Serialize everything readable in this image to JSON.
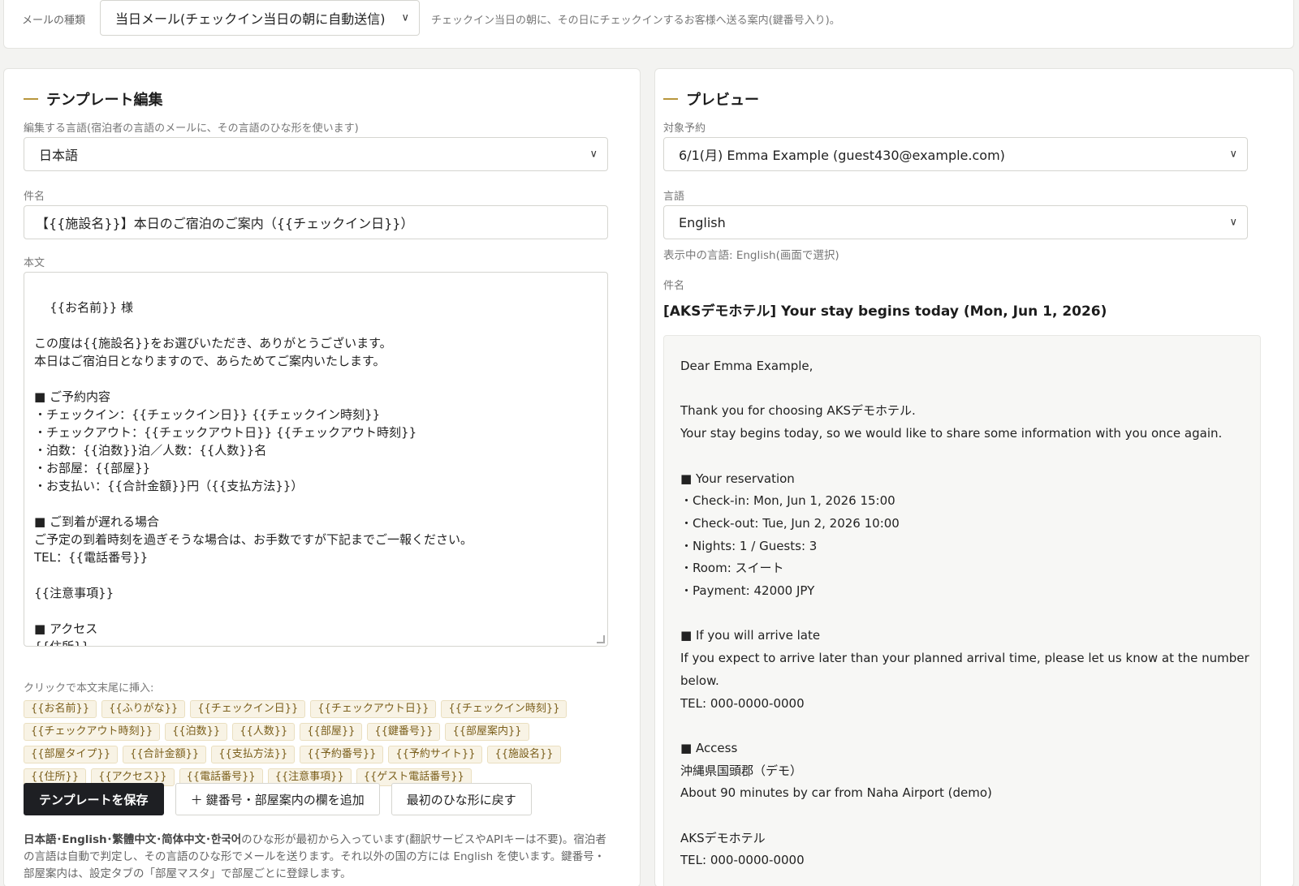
{
  "top": {
    "label": "メールの種類",
    "select_value": "当日メール(チェックイン当日の朝に自動送信)",
    "description": "チェックイン当日の朝に、その日にチェックインするお客様へ送る案内(鍵番号入り)。"
  },
  "editor": {
    "title": "テンプレート編集",
    "lang_label": "編集する言語(宿泊者の言語のメールに、その言語のひな形を使います)",
    "lang_value": "日本語",
    "subject_label": "件名",
    "subject_value": "【{{施設名}}】本日のご宿泊のご案内（{{チェックイン日}}）",
    "body_label": "本文",
    "body_value": "{{お名前}} 様\n\nこの度は{{施設名}}をお選びいただき、ありがとうございます。\n本日はご宿泊日となりますので、あらためてご案内いたします。\n\n■ ご予約内容\n・チェックイン：{{チェックイン日}} {{チェックイン時刻}}\n・チェックアウト：{{チェックアウト日}} {{チェックアウト時刻}}\n・泊数：{{泊数}}泊／人数：{{人数}}名\n・お部屋：{{部屋}}\n・お支払い：{{合計金額}}円（{{支払方法}}）\n\n■ ご到着が遅れる場合\nご予定の到着時刻を過ぎそうな場合は、お手数ですが下記までご一報ください。\nTEL：{{電話番号}}\n\n{{注意事項}}\n\n■ アクセス\n{{住所}}\n{{アクセス}}",
    "insert_hint": "クリックで本文末尾に挿入:",
    "chips": [
      "{{お名前}}",
      "{{ふりがな}}",
      "{{チェックイン日}}",
      "{{チェックアウト日}}",
      "{{チェックイン時刻}}",
      "{{チェックアウト時刻}}",
      "{{泊数}}",
      "{{人数}}",
      "{{部屋}}",
      "{{鍵番号}}",
      "{{部屋案内}}",
      "{{部屋タイプ}}",
      "{{合計金額}}",
      "{{支払方法}}",
      "{{予約番号}}",
      "{{予約サイト}}",
      "{{施設名}}",
      "{{住所}}",
      "{{アクセス}}",
      "{{電話番号}}",
      "{{注意事項}}",
      "{{ゲスト電話番号}}"
    ],
    "save_button": "テンプレートを保存",
    "add_button": "＋ 鍵番号・部屋案内の欄を追加",
    "reset_button": "最初のひな形に戻す",
    "note_bold": "日本語･English･繁體中文･简体中文･한국어",
    "note_rest": "のひな形が最初から入っています(翻訳サービスやAPIキーは不要)。宿泊者の言語は自動で判定し、その言語のひな形でメールを送ります。それ以外の国の方には English を使います。鍵番号・部屋案内は、設定タブの「部屋マスタ」で部屋ごとに登録します。"
  },
  "preview": {
    "title": "プレビュー",
    "target_label": "対象予約",
    "target_value": "6/1(月) Emma Example (guest430@example.com)",
    "lang_label": "言語",
    "lang_value": "English",
    "lang_note": "表示中の言語: English(画面で選択)",
    "subject_label": "件名",
    "subject_value": "[AKSデモホテル] Your stay begins today (Mon, Jun 1, 2026)",
    "body": "Dear Emma Example,\n\nThank you for choosing AKSデモホテル.\nYour stay begins today, so we would like to share some information with you once again.\n\n■ Your reservation\n・Check-in: Mon, Jun 1, 2026 15:00\n・Check-out: Tue, Jun 2, 2026 10:00\n・Nights: 1 / Guests: 3\n・Room: スイート\n・Payment: 42000 JPY\n\n■ If you will arrive late\nIf you expect to arrive later than your planned arrival time, please let us know at the number\nbelow.\nTEL: 000-0000-0000\n\n■ Access\n沖縄県国頭郡（デモ）\nAbout 90 minutes by car from Naha Airport (demo)\n\nAKSデモホテル\nTEL: 000-0000-0000"
  },
  "icons": {
    "chevron": "chevron-down-icon",
    "resize": "resize-handle-icon"
  },
  "colors": {
    "accent": "#b8963c",
    "primary_button": "#1e1f23",
    "chip_bg": "#f8f3e5",
    "chip_text": "#7a5e1a"
  }
}
